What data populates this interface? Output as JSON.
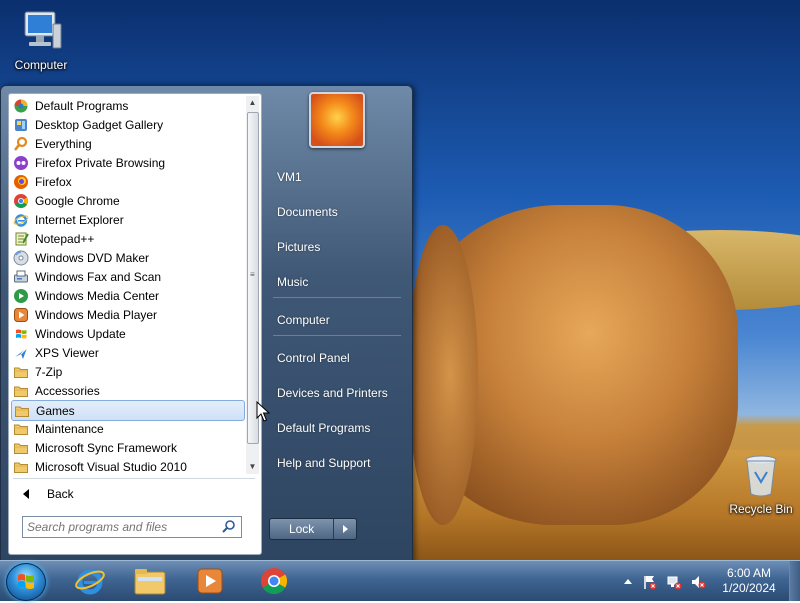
{
  "desktop": {
    "icons": [
      {
        "label": "Computer",
        "icon": "computer-icon"
      },
      {
        "label": "Recycle Bin",
        "icon": "recycle-bin-icon"
      }
    ]
  },
  "start_menu": {
    "programs": [
      {
        "label": "Default Programs",
        "icon": "default-programs-icon"
      },
      {
        "label": "Desktop Gadget Gallery",
        "icon": "gadget-gallery-icon"
      },
      {
        "label": "Everything",
        "icon": "everything-search-icon"
      },
      {
        "label": "Firefox Private Browsing",
        "icon": "firefox-private-icon"
      },
      {
        "label": "Firefox",
        "icon": "firefox-icon"
      },
      {
        "label": "Google Chrome",
        "icon": "chrome-icon"
      },
      {
        "label": "Internet Explorer",
        "icon": "internet-explorer-icon"
      },
      {
        "label": "Notepad++",
        "icon": "notepad-plus-plus-icon"
      },
      {
        "label": "Windows DVD Maker",
        "icon": "dvd-maker-icon"
      },
      {
        "label": "Windows Fax and Scan",
        "icon": "fax-scan-icon"
      },
      {
        "label": "Windows Media Center",
        "icon": "media-center-icon"
      },
      {
        "label": "Windows Media Player",
        "icon": "media-player-icon"
      },
      {
        "label": "Windows Update",
        "icon": "windows-update-icon"
      },
      {
        "label": "XPS Viewer",
        "icon": "xps-viewer-icon"
      },
      {
        "label": "7-Zip",
        "icon": "folder-icon"
      },
      {
        "label": "Accessories",
        "icon": "folder-icon"
      },
      {
        "label": "Games",
        "icon": "folder-icon",
        "selected": true
      },
      {
        "label": "Maintenance",
        "icon": "folder-icon"
      },
      {
        "label": "Microsoft Sync Framework",
        "icon": "folder-icon"
      },
      {
        "label": "Microsoft Visual Studio 2010",
        "icon": "folder-icon"
      }
    ],
    "back_label": "Back",
    "search_placeholder": "Search programs and files",
    "right_links": [
      "VM1",
      "Documents",
      "Pictures",
      "Music",
      "Computer",
      "Control Panel",
      "Devices and Printers",
      "Default Programs",
      "Help and Support"
    ],
    "lock_label": "Lock"
  },
  "taskbar": {
    "apps": [
      "internet-explorer-icon",
      "file-explorer-icon",
      "media-player-icon",
      "chrome-icon"
    ],
    "clock_time": "6:00 AM",
    "clock_date": "1/20/2024"
  },
  "colors": {
    "accent_blue": "#2d8fd8",
    "menu_frame": "#3f5876",
    "selection": "#cfe0f6"
  }
}
